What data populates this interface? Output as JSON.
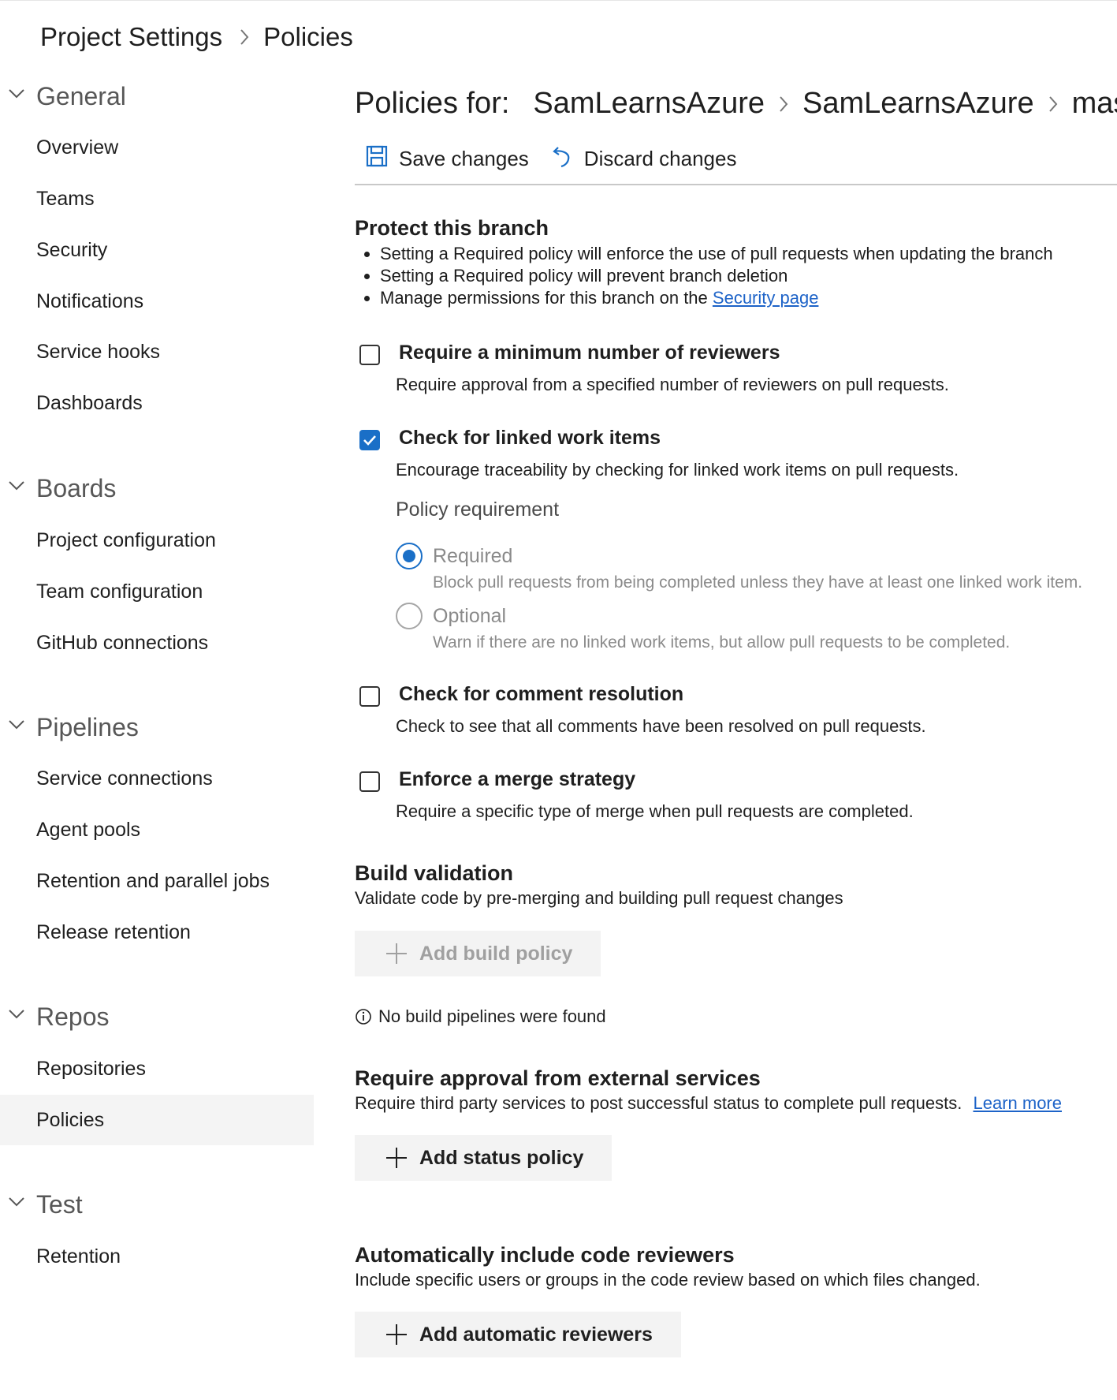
{
  "breadcrumb": {
    "root": "Project Settings",
    "current": "Policies"
  },
  "sidebar": {
    "groups": [
      {
        "label": "General",
        "items": [
          "Overview",
          "Teams",
          "Security",
          "Notifications",
          "Service hooks",
          "Dashboards"
        ]
      },
      {
        "label": "Boards",
        "items": [
          "Project configuration",
          "Team configuration",
          "GitHub connections"
        ]
      },
      {
        "label": "Pipelines",
        "items": [
          "Service connections",
          "Agent pools",
          "Retention and parallel jobs",
          "Release retention"
        ]
      },
      {
        "label": "Repos",
        "items": [
          "Repositories",
          "Policies"
        ]
      },
      {
        "label": "Test",
        "items": [
          "Retention"
        ]
      }
    ],
    "selected": "Policies"
  },
  "header": {
    "label": "Policies for:",
    "project": "SamLearnsAzure",
    "repo": "SamLearnsAzure",
    "branch": "master"
  },
  "toolbar": {
    "save": "Save changes",
    "discard": "Discard changes"
  },
  "protect": {
    "title": "Protect this branch",
    "bullets": [
      "Setting a Required policy will enforce the use of pull requests when updating the branch",
      "Setting a Required policy will prevent branch deletion"
    ],
    "permissions_prefix": "Manage permissions for this branch on the",
    "permissions_link": "Security page"
  },
  "policies": {
    "min_reviewers": {
      "title": "Require a minimum number of reviewers",
      "desc": "Require approval from a specified number of reviewers on pull requests.",
      "checked": false
    },
    "linked_work_items": {
      "title": "Check for linked work items",
      "desc": "Encourage traceability by checking for linked work items on pull requests.",
      "checked": true
    },
    "comment_resolution": {
      "title": "Check for comment resolution",
      "desc": "Check to see that all comments have been resolved on pull requests.",
      "checked": false
    },
    "merge_strategy": {
      "title": "Enforce a merge strategy",
      "desc": "Require a specific type of merge when pull requests are completed.",
      "checked": false
    }
  },
  "requirement": {
    "label": "Policy requirement",
    "required_label": "Required",
    "required_desc": "Block pull requests from being completed unless they have at least one linked work item.",
    "optional_label": "Optional",
    "optional_desc": "Warn if there are no linked work items, but allow pull requests to be completed.",
    "selected": "Required"
  },
  "build_validation": {
    "title": "Build validation",
    "desc": "Validate code by pre-merging and building pull request changes",
    "button": "Add build policy",
    "info": "No build pipelines were found"
  },
  "external_services": {
    "title": "Require approval from external services",
    "desc": "Require third party services to post successful status to complete pull requests.",
    "link": "Learn more",
    "button": "Add status policy"
  },
  "code_reviewers": {
    "title": "Automatically include code reviewers",
    "desc": "Include specific users or groups in the code review based on which files changed.",
    "button": "Add automatic reviewers"
  },
  "colors": {
    "accent": "#1a6fc7",
    "link": "#1d63c8",
    "selected_bg": "#f4f4f4",
    "button_bg": "#f3f3f3"
  }
}
